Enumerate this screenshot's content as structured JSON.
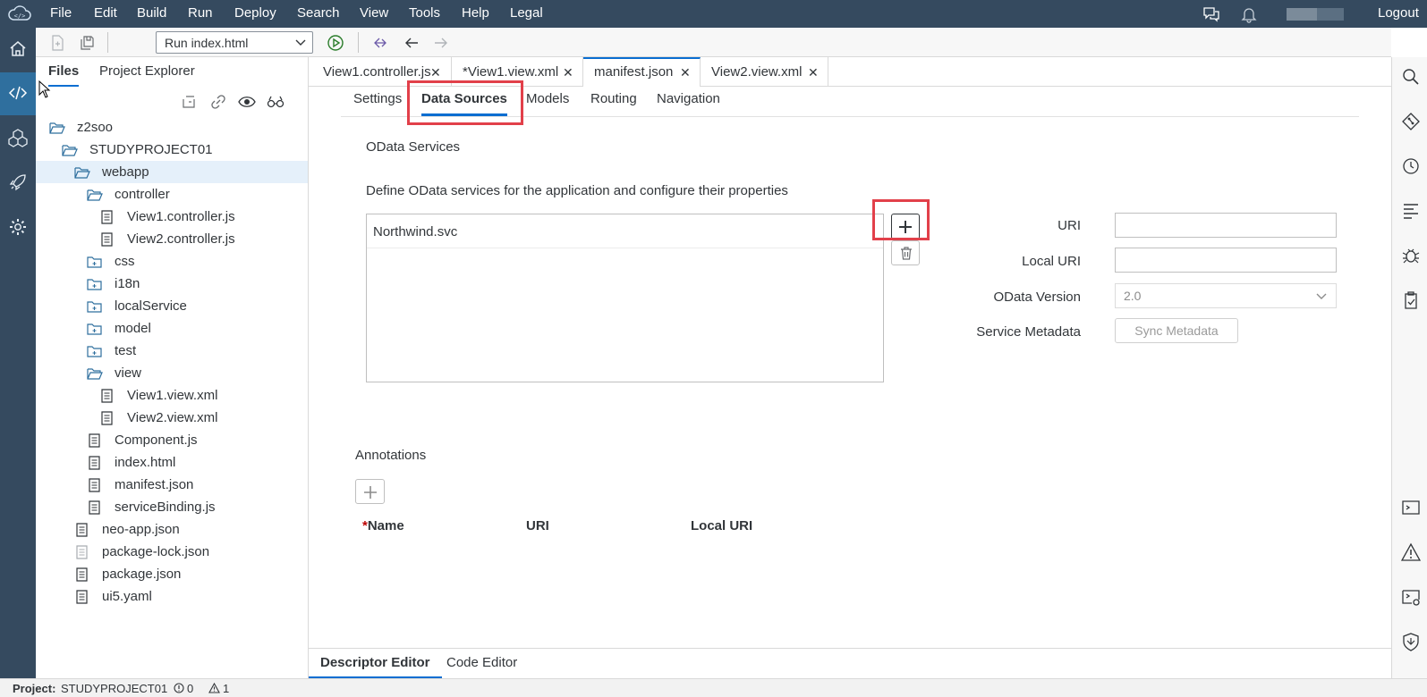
{
  "menubar": {
    "items": [
      "File",
      "Edit",
      "Build",
      "Run",
      "Deploy",
      "Search",
      "View",
      "Tools",
      "Help",
      "Legal"
    ],
    "logout_label": "Logout",
    "bg_color": "#354a5f"
  },
  "left_rail": {
    "items": [
      {
        "name": "home",
        "icon": "home-icon"
      },
      {
        "name": "development",
        "icon": "code-icon",
        "active": true
      },
      {
        "name": "extensions",
        "icon": "cubes-icon"
      },
      {
        "name": "deploy",
        "icon": "rocket-icon"
      },
      {
        "name": "preferences",
        "icon": "gear-icon"
      }
    ]
  },
  "toolbar": {
    "run_config": "Run index.html"
  },
  "files_panel": {
    "tabs": [
      "Files",
      "Project Explorer"
    ],
    "active_tab": "Files",
    "tree": [
      {
        "label": "z2soo",
        "type": "folder-open",
        "depth": 0
      },
      {
        "label": "STUDYPROJECT01",
        "type": "folder-open",
        "depth": 1
      },
      {
        "label": "webapp",
        "type": "folder-open",
        "depth": 2,
        "selected": true
      },
      {
        "label": "controller",
        "type": "folder-open",
        "depth": 3
      },
      {
        "label": "View1.controller.js",
        "type": "file",
        "depth": 4
      },
      {
        "label": "View2.controller.js",
        "type": "file",
        "depth": 4
      },
      {
        "label": "css",
        "type": "folder-closed",
        "depth": 3
      },
      {
        "label": "i18n",
        "type": "folder-closed",
        "depth": 3
      },
      {
        "label": "localService",
        "type": "folder-closed",
        "depth": 3
      },
      {
        "label": "model",
        "type": "folder-closed",
        "depth": 3
      },
      {
        "label": "test",
        "type": "folder-closed",
        "depth": 3
      },
      {
        "label": "view",
        "type": "folder-open",
        "depth": 3
      },
      {
        "label": "View1.view.xml",
        "type": "file",
        "depth": 4
      },
      {
        "label": "View2.view.xml",
        "type": "file",
        "depth": 4
      },
      {
        "label": "Component.js",
        "type": "file",
        "depth": 3
      },
      {
        "label": "index.html",
        "type": "file",
        "depth": 3
      },
      {
        "label": "manifest.json",
        "type": "file",
        "depth": 3
      },
      {
        "label": "serviceBinding.js",
        "type": "file",
        "depth": 3
      },
      {
        "label": "neo-app.json",
        "type": "file",
        "depth": 2
      },
      {
        "label": "package-lock.json",
        "type": "file-light",
        "depth": 2
      },
      {
        "label": "package.json",
        "type": "file",
        "depth": 2
      },
      {
        "label": "ui5.yaml",
        "type": "file",
        "depth": 2
      }
    ]
  },
  "editor": {
    "file_tabs": [
      {
        "label": "View1.controller.js"
      },
      {
        "label": "*View1.view.xml"
      },
      {
        "label": "manifest.json",
        "active": true
      },
      {
        "label": "View2.view.xml"
      }
    ],
    "sub_tabs": [
      "Settings",
      "Data Sources",
      "Models",
      "Routing",
      "Navigation"
    ],
    "active_sub_tab": "Data Sources",
    "odata": {
      "title": "OData Services",
      "description": "Define OData services for the application and configure their properties",
      "services": [
        "Northwind.svc"
      ],
      "props": {
        "uri_label": "URI",
        "local_uri_label": "Local URI",
        "version_label": "OData Version",
        "version_value": "2.0",
        "metadata_label": "Service Metadata",
        "sync_button": "Sync Metadata"
      }
    },
    "annotations": {
      "title": "Annotations",
      "required_marker": "*",
      "columns": [
        "Name",
        "URI",
        "Local URI"
      ]
    },
    "bottom_tabs": [
      "Descriptor Editor",
      "Code Editor"
    ],
    "active_bottom_tab": "Descriptor Editor"
  },
  "statusbar": {
    "project_label": "Project:",
    "project_name": "STUDYPROJECT01",
    "errors": "0",
    "warnings": "1"
  },
  "colors": {
    "accent": "#0a6ed1",
    "highlight": "#e2404a",
    "shell": "#354a5f"
  }
}
